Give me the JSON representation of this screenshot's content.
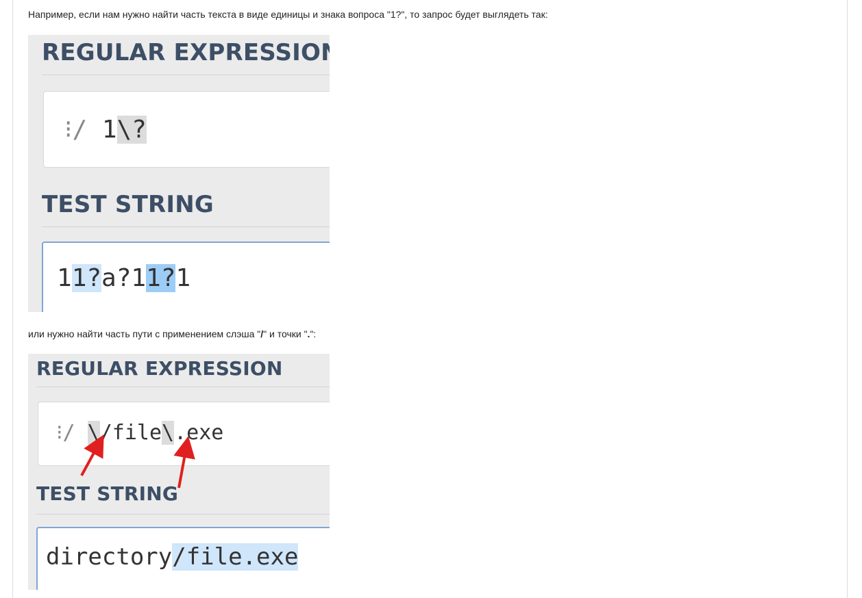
{
  "article": {
    "para1": "Например, если нам нужно найти часть текста в виде единицы и знака вопроса \"1?\", то запрос будет выглядеть так:",
    "para2_prefix": "или нужно найти часть пути с применением слэша \"",
    "para2_slash": "/",
    "para2_mid": "\" и точки \"",
    "para2_dot": ".",
    "para2_suffix": "\":"
  },
  "screenshot1": {
    "regex_header": "REGULAR EXPRESSION",
    "regex_flag": "⁝/",
    "regex_plain": "1",
    "regex_escaped": "\\?",
    "test_header": "TEST STRING",
    "test_parts": [
      "1",
      "1?",
      "a?1",
      "1?",
      "1"
    ]
  },
  "screenshot2": {
    "regex_header": "REGULAR EXPRESSION",
    "regex_flag": "⁝/",
    "regex_esc1": "\\",
    "regex_part1": "/file",
    "regex_esc2": "\\",
    "regex_part2": ".exe",
    "test_header": "TEST STRING",
    "test_plain": "directory",
    "test_match": "/file.exe",
    "arrow_color": "#e02020"
  }
}
